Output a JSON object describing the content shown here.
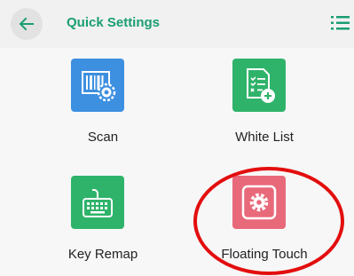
{
  "header": {
    "title": "Quick Settings",
    "back_icon": "arrow-left-icon",
    "menu_icon": "list-menu-icon"
  },
  "tiles": [
    {
      "label": "Scan",
      "icon": "barcode-gear-icon",
      "color": "#3d8fe0"
    },
    {
      "label": "White List",
      "icon": "checklist-add-icon",
      "color": "#2fb36a"
    },
    {
      "label": "Key Remap",
      "icon": "keyboard-icon",
      "color": "#2fb36a"
    },
    {
      "label": "Floating Touch",
      "icon": "gear-square-icon",
      "color": "#e8697a"
    }
  ],
  "colors": {
    "accent": "#1a9e74",
    "header_bg": "#f1f1f1",
    "highlight": "#e30e0e"
  }
}
